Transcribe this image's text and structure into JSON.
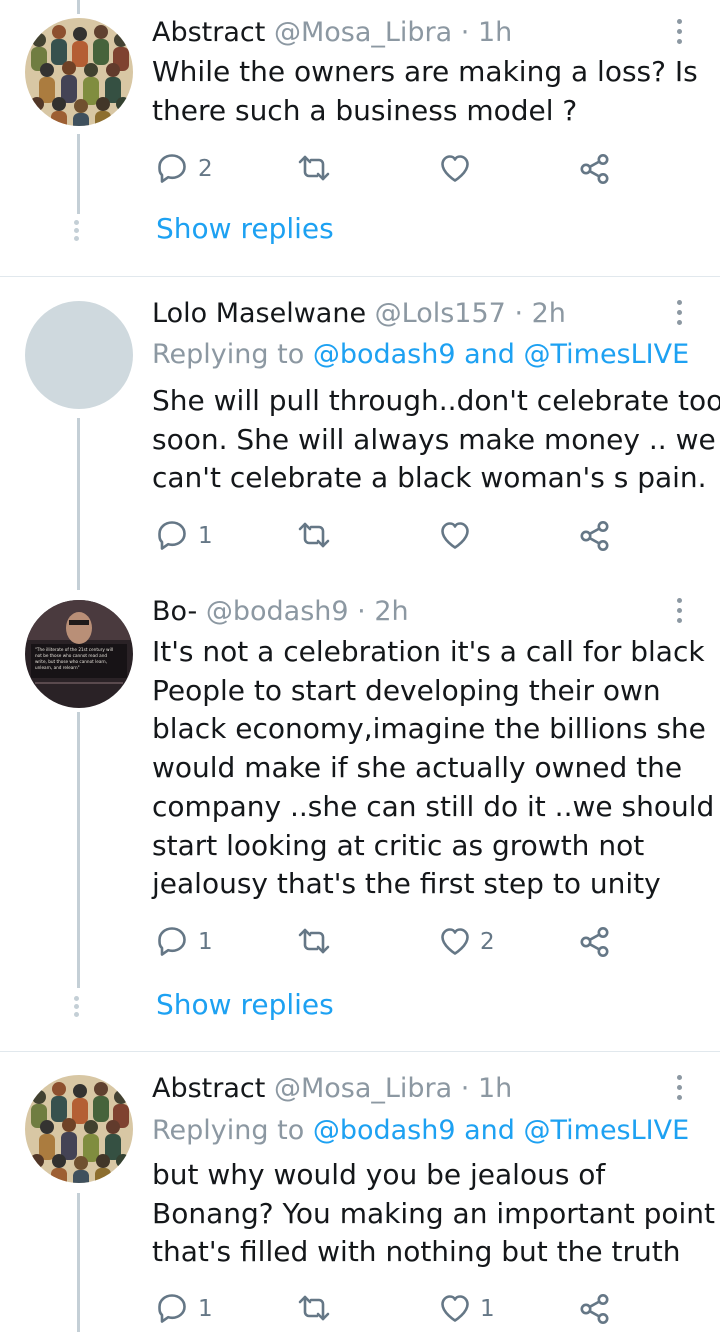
{
  "tweets": [
    {
      "name": "Abstract",
      "handle": "@Mosa_Libra",
      "sep": " · ",
      "time": "1h",
      "lines": [
        "While the owners are making a loss? Is",
        "there such a business model ?"
      ],
      "reply_count": "2",
      "retweet_count": "",
      "like_count": "",
      "show_replies": "Show replies"
    },
    {
      "name": "Lolo Maselwane",
      "handle": "@Lols157",
      "sep": " · ",
      "time": "2h",
      "replying_prefix": "Replying to ",
      "replying_to_1": "@bodash9",
      "replying_and": " and ",
      "replying_to_2": "@TimesLIVE",
      "lines": [
        "She will pull through..don't celebrate too",
        "soon. She will always make money .. we",
        "can't celebrate a black woman's s pain."
      ],
      "reply_count": "1",
      "retweet_count": "",
      "like_count": ""
    },
    {
      "name": "Bo-",
      "handle": "@bodash9",
      "sep": " · ",
      "time": "2h",
      "lines": [
        "It's not a celebration it's a call for black",
        "People to start developing their own",
        "black economy,imagine the billions she",
        "would make if she actually owned the",
        "company ..she can still do it ..we should",
        "start looking at critic as growth not",
        "jealousy that's the first step to unity"
      ],
      "reply_count": "1",
      "retweet_count": "",
      "like_count": "2",
      "show_replies": "Show replies"
    },
    {
      "name": "Abstract",
      "handle": "@Mosa_Libra",
      "sep": " · ",
      "time": "1h",
      "replying_prefix": "Replying to ",
      "replying_to_1": "@bodash9",
      "replying_and": " and ",
      "replying_to_2": "@TimesLIVE",
      "lines": [
        "but why would you be jealous of",
        "Bonang? You making an important point",
        "that's filled with nothing but the truth"
      ],
      "reply_count": "1",
      "retweet_count": "",
      "like_count": "1"
    }
  ],
  "colors": {
    "link": "#1da1f2",
    "muted": "#8c98a2",
    "icon": "#657786",
    "thread_line": "#c4cfd6",
    "divider": "#e1e8ed"
  },
  "icons": [
    "reply-icon",
    "retweet-icon",
    "like-icon",
    "share-icon",
    "more-options-icon"
  ]
}
